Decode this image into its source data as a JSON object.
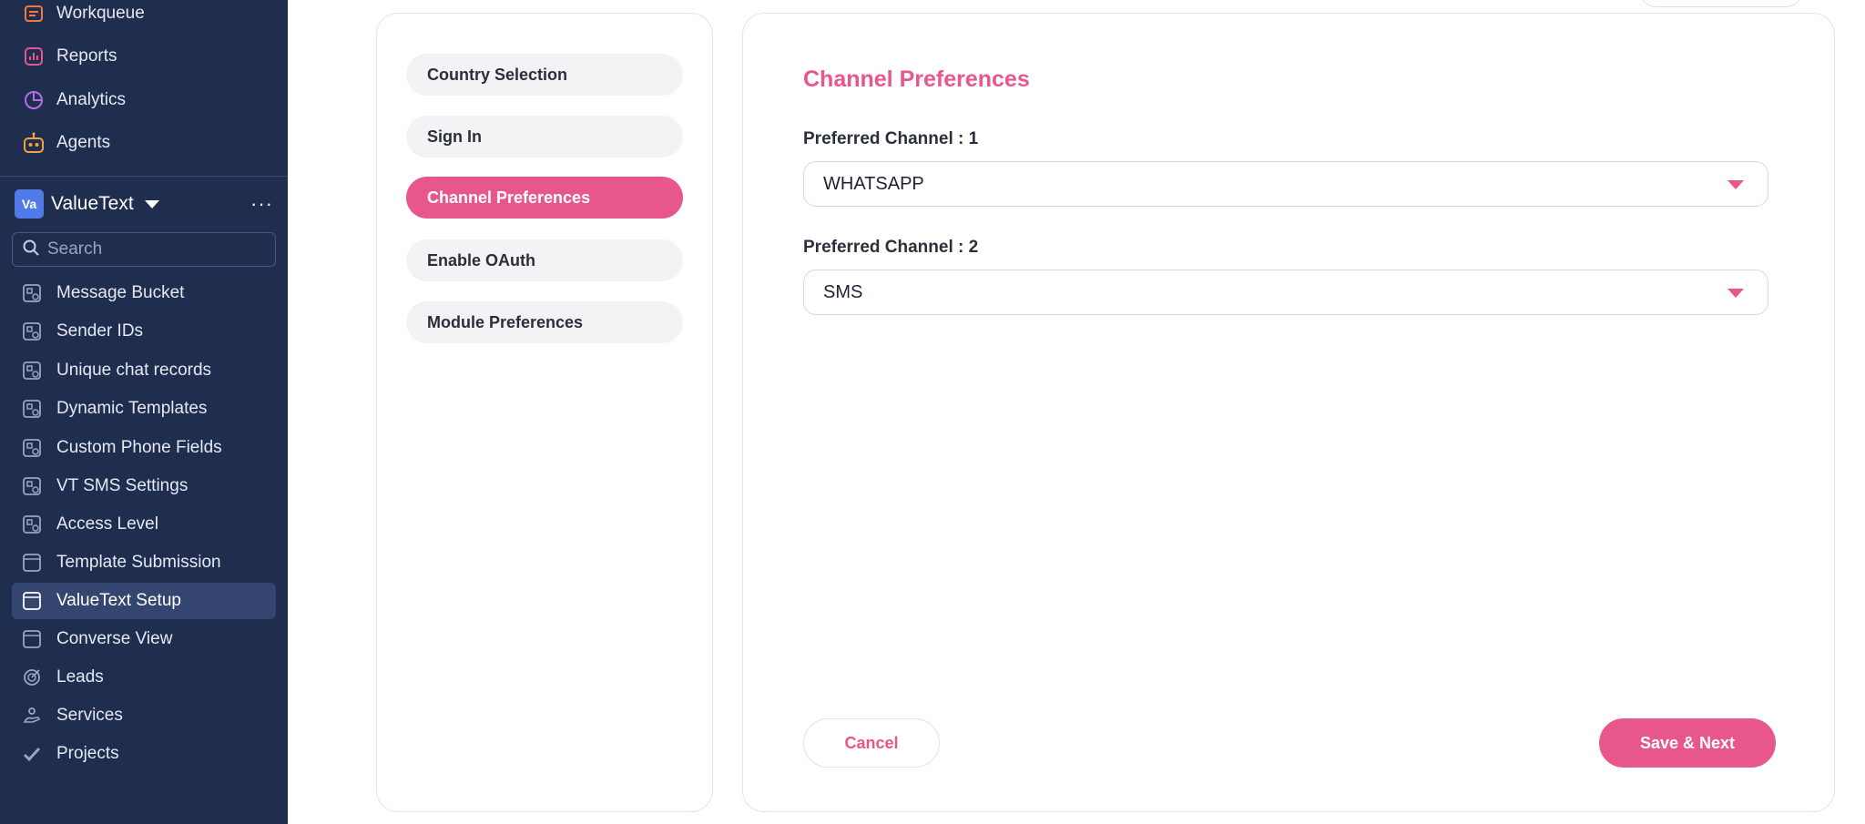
{
  "sidebar": {
    "top_items": [
      {
        "label": "Workqueue",
        "icon": "workqueue-icon",
        "color": "#f07a3c"
      },
      {
        "label": "Reports",
        "icon": "reports-icon",
        "color": "#e8578b"
      },
      {
        "label": "Analytics",
        "icon": "analytics-icon",
        "color": "#b46ee6"
      },
      {
        "label": "Agents",
        "icon": "agents-icon",
        "color": "#f2a43c"
      }
    ],
    "workspace": {
      "badge": "Va",
      "name": "ValueText",
      "more": "···"
    },
    "search": {
      "placeholder": "Search"
    },
    "items": [
      {
        "label": "Message Bucket",
        "icon": "module-icon"
      },
      {
        "label": "Sender IDs",
        "icon": "module-icon"
      },
      {
        "label": "Unique chat records",
        "icon": "module-icon"
      },
      {
        "label": "Dynamic Templates",
        "icon": "module-icon"
      },
      {
        "label": "Custom Phone Fields",
        "icon": "module-icon"
      },
      {
        "label": "VT SMS Settings",
        "icon": "module-icon"
      },
      {
        "label": "Access Level",
        "icon": "module-icon"
      },
      {
        "label": "Template Submission",
        "icon": "page-icon"
      },
      {
        "label": "ValueText Setup",
        "icon": "page-icon",
        "active": true
      },
      {
        "label": "Converse View",
        "icon": "page-icon"
      },
      {
        "label": "Leads",
        "icon": "leads-icon"
      },
      {
        "label": "Services",
        "icon": "services-icon"
      },
      {
        "label": "Projects",
        "icon": "projects-icon"
      }
    ]
  },
  "steps": [
    {
      "label": "Country Selection"
    },
    {
      "label": "Sign In"
    },
    {
      "label": "Channel Preferences",
      "active": true
    },
    {
      "label": "Enable OAuth"
    },
    {
      "label": "Module Preferences"
    }
  ],
  "form": {
    "title": "Channel Preferences",
    "channel1_label": "Preferred Channel : 1",
    "channel1_value": "WHATSAPP",
    "channel2_label": "Preferred Channel : 2",
    "channel2_value": "SMS",
    "cancel_label": "Cancel",
    "save_label": "Save & Next"
  },
  "colors": {
    "accent": "#e8578b",
    "sidebar_bg": "#1f2d4e"
  }
}
